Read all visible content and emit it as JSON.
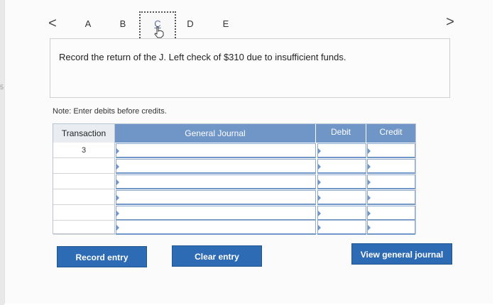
{
  "left_strip": {
    "mark": "5"
  },
  "navigation": {
    "prev_glyph": "<",
    "next_glyph": ">",
    "tabs": [
      {
        "label": "A"
      },
      {
        "label": "B"
      },
      {
        "label": "C",
        "active": true
      },
      {
        "label": "D"
      },
      {
        "label": "E"
      }
    ]
  },
  "instruction": "Record the return of the J. Left check of $310 due to insufficient funds.",
  "note": "Note: Enter debits before credits.",
  "journal": {
    "headers": {
      "transaction": "Transaction",
      "general_journal": "General Journal",
      "debit": "Debit",
      "credit": "Credit"
    },
    "rows": [
      {
        "transaction": "3",
        "general_journal": "",
        "debit": "",
        "credit": ""
      },
      {
        "transaction": "",
        "general_journal": "",
        "debit": "",
        "credit": ""
      },
      {
        "transaction": "",
        "general_journal": "",
        "debit": "",
        "credit": ""
      },
      {
        "transaction": "",
        "general_journal": "",
        "debit": "",
        "credit": ""
      },
      {
        "transaction": "",
        "general_journal": "",
        "debit": "",
        "credit": ""
      },
      {
        "transaction": "",
        "general_journal": "",
        "debit": "",
        "credit": ""
      }
    ]
  },
  "buttons": {
    "record_entry": "Record entry",
    "clear_entry": "Clear entry",
    "view_general_journal": "View general journal"
  },
  "colors": {
    "header_blue": "#6f96c7",
    "button_blue": "#2d6bb4"
  }
}
